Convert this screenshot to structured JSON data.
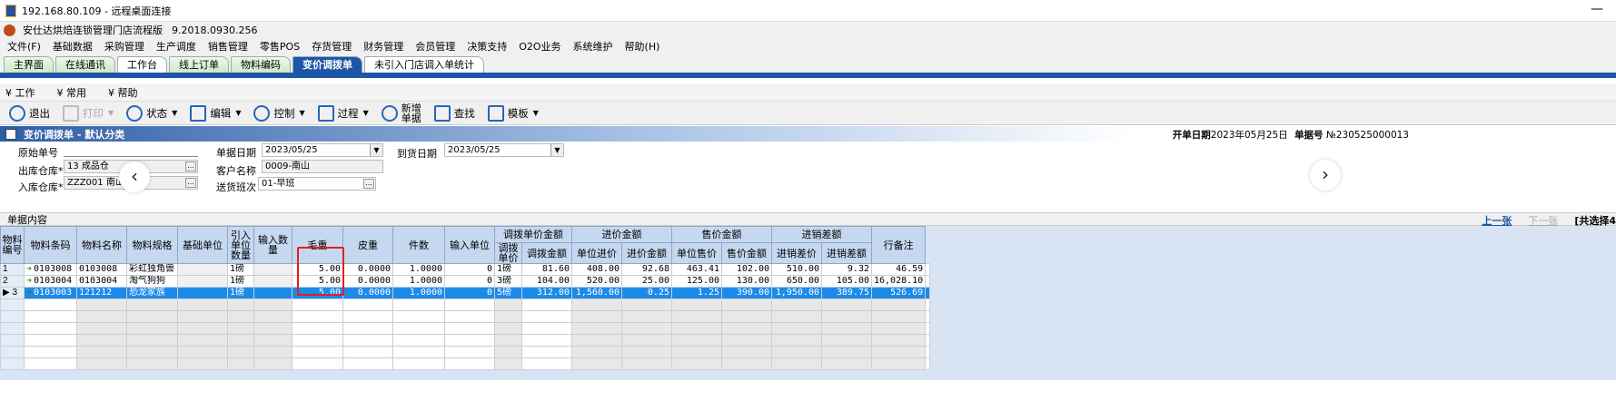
{
  "window": {
    "title": "192.168.80.109 - 远程桌面连接",
    "minimize": "—"
  },
  "app": {
    "title": "安仕达烘焙连锁管理门店流程版",
    "version": "9.2018.0930.256"
  },
  "menu": [
    "文件(F)",
    "基础数据",
    "采购管理",
    "生产调度",
    "销售管理",
    "零售POS",
    "存货管理",
    "财务管理",
    "会员管理",
    "决策支持",
    "O2O业务",
    "系统维护",
    "帮助(H)"
  ],
  "tabs": [
    "主界面",
    "在线通讯",
    "工作台",
    "线上订单",
    "物料编码",
    "变价调拨单",
    "未引入门店调入单统计"
  ],
  "workspace": [
    "工作",
    "常用",
    "帮助"
  ],
  "toolbar": {
    "exit": "退出",
    "print": "打印",
    "status": "状态",
    "edit": "编辑",
    "control": "控制",
    "process": "过程",
    "new1": "新增",
    "new2": "单据",
    "find": "查找",
    "template": "模板"
  },
  "form": {
    "title": "变价调拨单 - 默认分类",
    "open_date_label": "开单日期",
    "open_date": "2023年05月25日",
    "doc_no_label": "单据号",
    "doc_no": "№230525000013",
    "orig_no_label": "原始单号",
    "orig_no": "",
    "out_wh_label": "出库仓库*",
    "out_wh": "13 成品仓",
    "in_wh_label": "入库仓库*",
    "in_wh": "ZZZ001 南山",
    "doc_date_label": "单据日期",
    "doc_date": "2023/05/25",
    "customer_label": "客户名称",
    "customer": "0009-南山",
    "shift_label": "送货班次",
    "shift": "01-早班",
    "arrive_label": "到货日期",
    "arrive_date": "2023/05/25"
  },
  "section": {
    "title": "单据内容",
    "prev": "上一张",
    "next": "下一张",
    "selected": "[共选择4"
  },
  "grid": {
    "headers": {
      "code": "物料编号",
      "barcode": "物料条码",
      "name": "物料名称",
      "spec": "物料规格",
      "unit": "基础单位",
      "ref_qty": "引入单位数量",
      "qty": "输入数量",
      "gross": "毛重",
      "tare": "皮重",
      "pieces": "件数",
      "in_unit": "输入单位",
      "grp_transfer": "调拨单价金额",
      "transfer_price": "调拨单价",
      "transfer_amt": "调拨金额",
      "grp_purchase": "进价金额",
      "unit_cost": "单位进价",
      "cost_amt": "进价金额",
      "grp_sale": "售价金额",
      "unit_sale": "单位售价",
      "sale_amt": "售价金额",
      "grp_diff": "进销差额",
      "diff_price": "进销差价",
      "diff_amt": "进销差额",
      "remark": "行备注"
    },
    "rows": [
      {
        "idx": "1",
        "code": "0103008",
        "barcode": "0103008",
        "name": "彩虹独角兽",
        "unit": "1磅",
        "qty": "5.00",
        "gross": "0.0000",
        "tare": "1.0000",
        "pieces": "0",
        "in_unit": "1磅",
        "transfer_price": "81.60",
        "transfer_amt": "408.00",
        "unit_cost": "92.68",
        "cost_amt": "463.41",
        "unit_sale": "102.00",
        "sale_amt": "510.00",
        "diff_price": "9.32",
        "diff_amt": "46.59"
      },
      {
        "idx": "2",
        "code": "0103004",
        "barcode": "0103004",
        "name": "淘气狗狗",
        "unit": "1磅",
        "qty": "5.00",
        "gross": "0.0000",
        "tare": "1.0000",
        "pieces": "0",
        "in_unit": "3磅",
        "transfer_price": "104.00",
        "transfer_amt": "520.00",
        "unit_cost": "25.00",
        "cost_amt": "125.00",
        "unit_sale": "130.00",
        "sale_amt": "650.00",
        "diff_price": "105.00",
        "diff_amt": "16,028.10"
      },
      {
        "idx": "3",
        "code": "0103003",
        "barcode": "121212",
        "name": "恐龙家族",
        "unit": "1磅",
        "qty": "5.00",
        "gross": "0.0000",
        "tare": "1.0000",
        "pieces": "0",
        "in_unit": "5磅",
        "transfer_price": "312.00",
        "transfer_amt": "1,560.00",
        "unit_cost": "0.25",
        "cost_amt": "1.25",
        "unit_sale": "390.00",
        "sale_amt": "1,950.00",
        "diff_price": "389.75",
        "diff_amt": "526.69"
      }
    ]
  }
}
